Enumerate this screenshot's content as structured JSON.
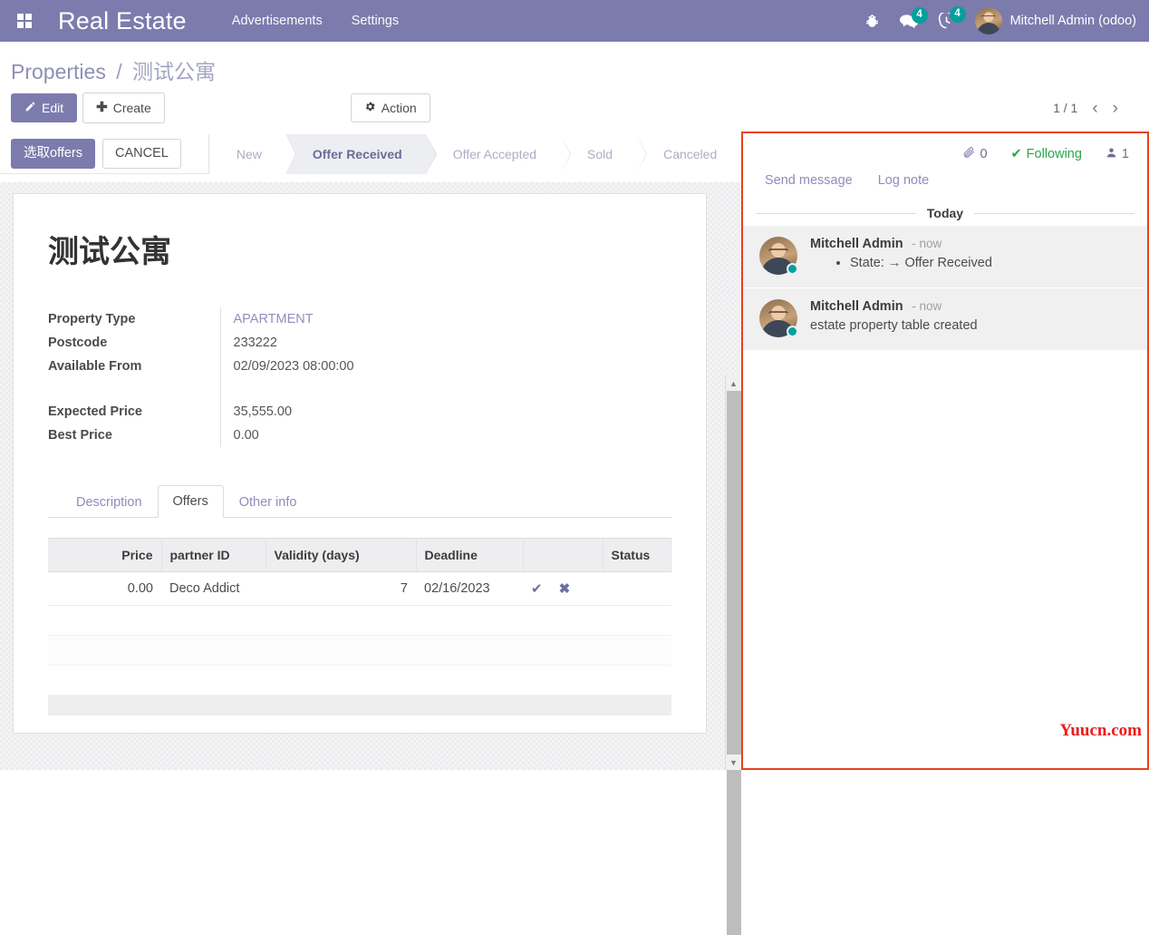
{
  "navbar": {
    "apps_icon": "apps-grid-icon",
    "brand": "Real Estate",
    "menu": [
      {
        "label": "Advertisements"
      },
      {
        "label": "Settings"
      }
    ],
    "debug_icon": "bug-icon",
    "messages": {
      "icon": "chat-bubble-icon",
      "count": "4"
    },
    "activities": {
      "icon": "clock-icon",
      "count": "4"
    },
    "user": {
      "name": "Mitchell Admin (odoo)",
      "avatar": "user-avatar"
    }
  },
  "control_panel": {
    "breadcrumb": {
      "root": "Properties",
      "separator": "/",
      "current": "测试公寓"
    },
    "edit_label": "Edit",
    "edit_icon": "pencil-icon",
    "create_label": "Create",
    "create_icon": "plus-icon",
    "action_label": "Action",
    "action_icon": "gear-icon",
    "pager": {
      "value": "1 / 1",
      "prev_icon": "chevron-left-icon",
      "next_icon": "chevron-right-icon"
    }
  },
  "statusbar": {
    "buttons": [
      {
        "label": "选取offers",
        "primary": true
      },
      {
        "label": "CANCEL",
        "primary": false
      }
    ],
    "stages": [
      {
        "label": "New",
        "active": false
      },
      {
        "label": "Offer Received",
        "active": true
      },
      {
        "label": "Offer Accepted",
        "active": false
      },
      {
        "label": "Sold",
        "active": false
      },
      {
        "label": "Canceled",
        "active": false
      }
    ]
  },
  "form": {
    "title": "测试公寓",
    "group_a": [
      {
        "label": "Property Type",
        "value": "APARTMENT",
        "link": true
      },
      {
        "label": "Postcode",
        "value": "233222",
        "link": false
      },
      {
        "label": "Available From",
        "value": "02/09/2023 08:00:00",
        "link": false
      }
    ],
    "group_b": [
      {
        "label": "Expected Price",
        "value": "35,555.00",
        "link": false
      },
      {
        "label": "Best Price",
        "value": "0.00",
        "link": false
      }
    ],
    "tabs": [
      {
        "label": "Description",
        "active": false
      },
      {
        "label": "Offers",
        "active": true
      },
      {
        "label": "Other info",
        "active": false
      }
    ],
    "offers_table": {
      "headers": [
        "Price",
        "partner ID",
        "Validity  (days)",
        "Deadline",
        "",
        "Status"
      ],
      "rows": [
        {
          "price": "0.00",
          "partner": "Deco Addict",
          "validity": "7",
          "deadline": "02/16/2023",
          "accept_icon": "check-icon",
          "refuse_icon": "cross-icon",
          "status": ""
        }
      ]
    }
  },
  "scrollbar": {
    "up_icon": "triangle-up-icon",
    "down_icon": "triangle-down-icon"
  },
  "chatter": {
    "attachments": {
      "icon": "paperclip-icon",
      "count": "0"
    },
    "following": {
      "icon": "check-icon",
      "label": "Following"
    },
    "followers": {
      "icon": "user-icon",
      "count": "1"
    },
    "send_message": "Send message",
    "log_note": "Log note",
    "day_separator": "Today",
    "messages": [
      {
        "author": "Mitchell Admin",
        "time": "- now",
        "bullet": true,
        "text": "State: → Offer Received"
      },
      {
        "author": "Mitchell Admin",
        "time": "- now",
        "bullet": false,
        "text": "estate property table created"
      }
    ]
  },
  "watermark": "Yuucn.com",
  "colors": {
    "brand_purple": "#7c7bad",
    "badge_teal": "#00a09d",
    "following_green": "#28a745",
    "annotation_red": "#e8411b",
    "watermark_red": "#ee1b1b"
  }
}
